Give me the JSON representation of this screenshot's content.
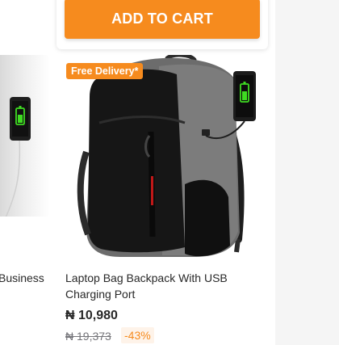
{
  "actions": {
    "add_to_cart_label": "ADD TO CART"
  },
  "products": [
    {
      "title": "Business"
    },
    {
      "badge": "Free Delivery*",
      "title": "Laptop Bag Backpack With USB Charging Port",
      "price": "₦ 10,980",
      "old_price": "₦ 19,373",
      "discount": "-43%"
    }
  ],
  "colors": {
    "accent": "#f68b1e",
    "text": "#282828",
    "muted": "#75757a"
  }
}
